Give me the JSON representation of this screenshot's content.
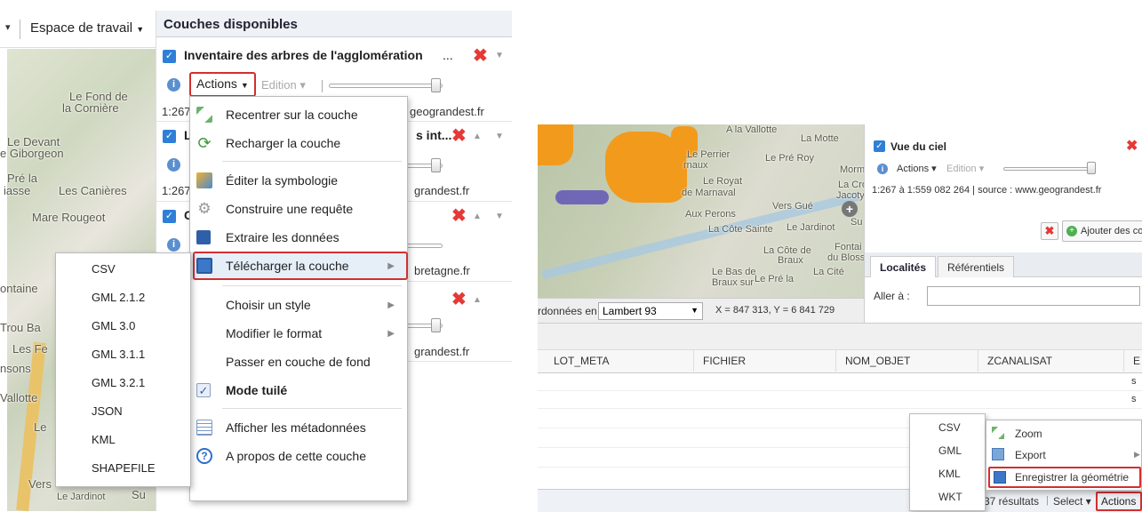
{
  "left_panel": {
    "toolbar": {
      "dropdown_arrow": "▾",
      "workspace_label": "Espace de travail"
    },
    "map_labels": [
      "Le Fond de",
      "la Cornière",
      "Le Devant",
      "e Giborgeon",
      "Pré la",
      "iasse",
      "Les Canières",
      "Mare Rougeot",
      "ontaine",
      "Trou Ba",
      "Les Fe",
      "nsons",
      "Vallotte",
      "Le",
      "Vers",
      "Le Jardinot",
      "Su"
    ],
    "layers_header": "Couches disponibles",
    "layer1": {
      "name": "Inventaire des arbres de l'agglomération",
      "ellipsis": "...",
      "actions_label": "Actions",
      "edition_label": "Edition",
      "scale": "1:267",
      "source_suffix": "geograndest.fr"
    },
    "layer2": {
      "name": "L",
      "name_suffix": "s int...",
      "scale": "1:267",
      "source_suffix": "grandest.fr"
    },
    "layer3": {
      "name": "C",
      "source_suffix": "bretagne.fr"
    },
    "layer4": {
      "source_suffix": "grandest.fr"
    },
    "context_menu": {
      "items": [
        {
          "label": "Recentrer sur la couche",
          "icon": "recenter-icon"
        },
        {
          "label": "Recharger la couche",
          "icon": "reload-icon"
        },
        {
          "label": "Éditer la symbologie",
          "icon": "symbology-icon"
        },
        {
          "label": "Construire une requête",
          "icon": "gear-icon"
        },
        {
          "label": "Extraire les données",
          "icon": "extract-icon"
        },
        {
          "label": "Télécharger la couche",
          "icon": "save-icon"
        },
        {
          "label": "Choisir un style",
          "icon": ""
        },
        {
          "label": "Modifier le format",
          "icon": ""
        },
        {
          "label": "Passer en couche de fond",
          "icon": ""
        },
        {
          "label": "Mode tuilé",
          "icon": "checkbox-icon"
        },
        {
          "label": "Afficher les métadonnées",
          "icon": "list-icon"
        },
        {
          "label": "A propos de cette couche",
          "icon": "help-icon"
        }
      ]
    },
    "formats_menu": [
      "CSV",
      "GML 2.1.2",
      "GML 3.0",
      "GML 3.1.1",
      "GML 3.2.1",
      "JSON",
      "KML",
      "SHAPEFILE"
    ]
  },
  "right_panel": {
    "map_labels": [
      "A la Vallotte",
      "La Motte",
      "Le Perrier",
      "rnaux",
      "Le Pré Roy",
      "Morm",
      "Le Royat",
      "de Marnaval",
      "La Croix",
      "Jacoty",
      "Vers Gué",
      "Aux Perons",
      "La Côte Sainte",
      "Le Jardinot",
      "Su",
      "Fontai",
      "du Bloss",
      "La Côte de",
      "Braux",
      "La Cité",
      "Le Bas de",
      "Braux sur",
      "Le Pré la"
    ],
    "coord_prefix": "rdonnées en",
    "projection": "Lambert 93",
    "coords": "X = 847 313, Y = 6 841 729",
    "layer": {
      "name": "Vue du ciel",
      "actions_label": "Actions",
      "edition_label": "Edition",
      "scale_source": "1:267 à 1:559 082 264 | source : www.geograndest.fr"
    },
    "add_layers_button": "Ajouter des couches",
    "tabs": [
      "Localités",
      "Référentiels"
    ],
    "goto_label": "Aller à :",
    "table_headers": [
      "LOT_META",
      "FICHIER",
      "NOM_OBJET",
      "ZCANALISAT",
      "E"
    ],
    "row_fragments": [
      "s",
      "s"
    ],
    "formats_menu": [
      "CSV",
      "GML",
      "KML",
      "WKT"
    ],
    "context_menu": [
      {
        "label": "Zoom",
        "icon": "zoom-icon"
      },
      {
        "label": "Export",
        "icon": "export-icon"
      },
      {
        "label": "Enregistrer la géométrie",
        "icon": "save-icon"
      }
    ],
    "footer": {
      "results": "37 résultats",
      "sep": "|",
      "select_label": "Select",
      "actions_label": "Actions"
    }
  }
}
